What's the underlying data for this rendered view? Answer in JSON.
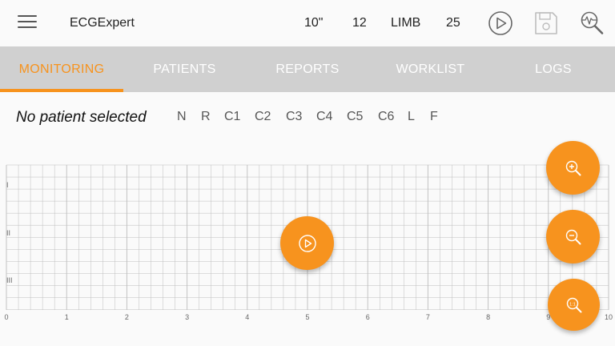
{
  "app": {
    "title": "ECGExpert"
  },
  "toolbar": {
    "speed": "10\"",
    "leads_count": "12",
    "mode": "LIMB",
    "gain": "25"
  },
  "tabs": [
    {
      "label": "MONITORING",
      "active": true
    },
    {
      "label": "PATIENTS",
      "active": false
    },
    {
      "label": "REPORTS",
      "active": false
    },
    {
      "label": "WORKLIST",
      "active": false
    },
    {
      "label": "LOGS",
      "active": false
    }
  ],
  "patient": {
    "status": "No patient selected"
  },
  "electrodes": [
    "N",
    "R",
    "C1",
    "C2",
    "C3",
    "C4",
    "C5",
    "C6",
    "L",
    "F"
  ],
  "ecg_grid": {
    "lead_labels": [
      "I",
      "II",
      "III"
    ],
    "time_ticks": [
      "0",
      "1",
      "2",
      "3",
      "4",
      "5",
      "6",
      "7",
      "8",
      "9",
      "10"
    ]
  },
  "colors": {
    "accent": "#f7931e",
    "tab_bar": "#d0d0d0",
    "grid_line": "#bdbdbd"
  },
  "icons": {
    "menu": "hamburger-icon",
    "play": "play-circle-icon",
    "save": "floppy-disk-icon",
    "analyze": "ecg-search-icon",
    "zoom_in": "zoom-in-icon",
    "zoom_out": "zoom-out-icon",
    "zoom_reset": "zoom-reset-icon"
  }
}
